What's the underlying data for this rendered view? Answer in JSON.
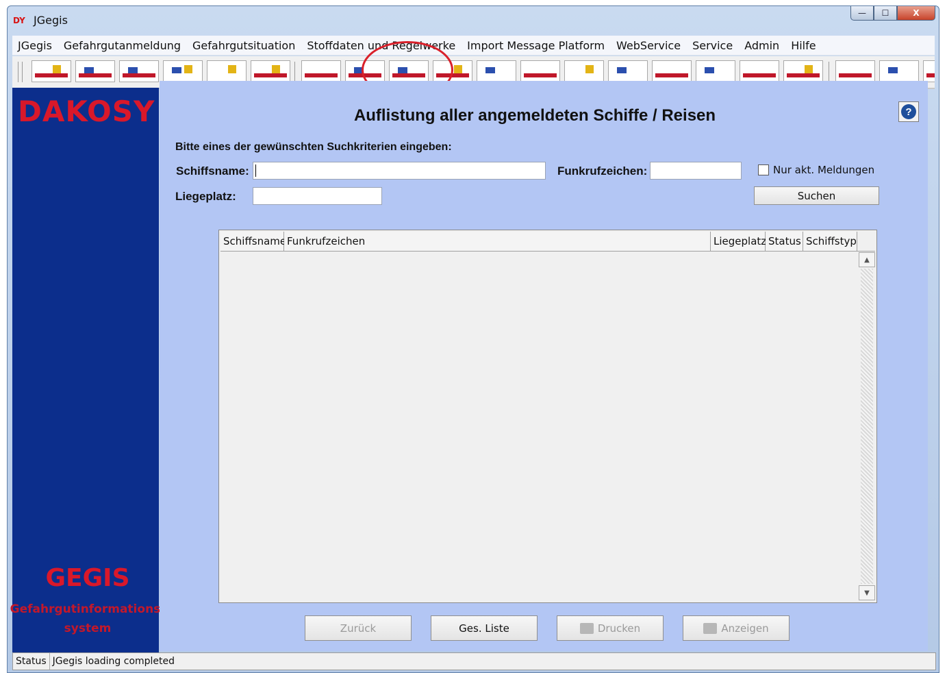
{
  "window": {
    "logo": "DY",
    "title": "JGegis",
    "controls": {
      "minimize": "—",
      "maximize": "☐",
      "close": "X"
    }
  },
  "menu": [
    "JGegis",
    "Gefahrgutanmeldung",
    "Gefahrgutsituation",
    "Stoffdaten und Regelwerke",
    "Import Message Platform",
    "WebService",
    "Service",
    "Admin",
    "Hilfe"
  ],
  "sidebar": {
    "brand": "DAKOSY",
    "product": "GEGIS",
    "subtitle_line1": "Gefahrgutinformations-",
    "subtitle_line2": "system"
  },
  "content": {
    "title": "Auflistung aller angemeldeten Schiffe / Reisen",
    "help_icon_text": "?",
    "instruction": "Bitte eines der gewünschten Suchkriterien eingeben:",
    "fields": {
      "schiffsname_label": "Schiffsname:",
      "schiffsname_value": "",
      "funkrufzeichen_label": "Funkrufzeichen:",
      "funkrufzeichen_value": "",
      "liegeplatz_label": "Liegeplatz:",
      "liegeplatz_value": ""
    },
    "checkbox_label": "Nur akt. Meldungen",
    "checkbox_checked": false,
    "search_button": "Suchen"
  },
  "table": {
    "columns": [
      "Schiffsname",
      "Funkrufzeichen",
      "Liegeplatz",
      "Status",
      "Schiffstyp"
    ],
    "rows": []
  },
  "buttons": {
    "back": "Zurück",
    "full_list": "Ges. Liste",
    "print": "Drucken",
    "show": "Anzeigen"
  },
  "status": {
    "label": "Status",
    "message": "JGegis loading completed"
  },
  "colors": {
    "sidebar": "#0c2e8c",
    "brand_red": "#d9182a",
    "content_bg": "#b3c6f4",
    "highlight_circle": "#d9202a"
  }
}
